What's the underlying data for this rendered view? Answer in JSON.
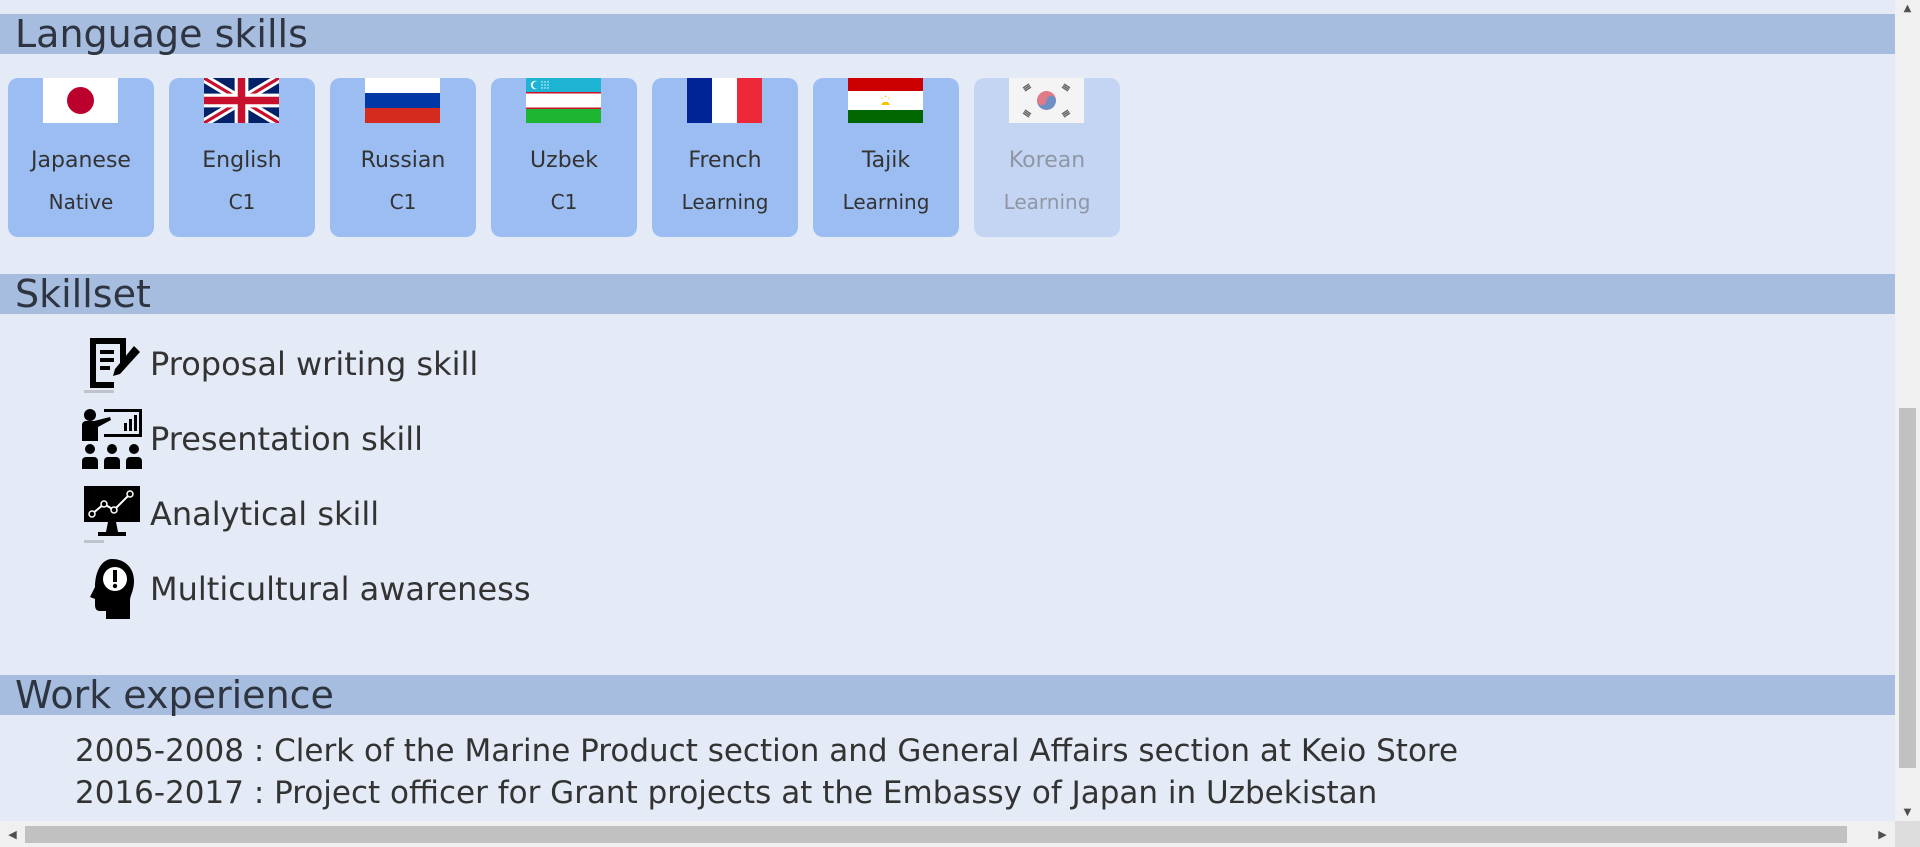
{
  "sections": {
    "languages_title": "Language skills",
    "skills_title": "Skillset",
    "work_title": "Work experience"
  },
  "languages": [
    {
      "name": "Japanese",
      "level": "Native",
      "flag": "japan-flag"
    },
    {
      "name": "English",
      "level": "C1",
      "flag": "uk-flag"
    },
    {
      "name": "Russian",
      "level": "C1",
      "flag": "russia-flag"
    },
    {
      "name": "Uzbek",
      "level": "C1",
      "flag": "uzbekistan-flag"
    },
    {
      "name": "French",
      "level": "Learning",
      "flag": "france-flag"
    },
    {
      "name": "Tajik",
      "level": "Learning",
      "flag": "tajikistan-flag"
    },
    {
      "name": "Korean",
      "level": "Learning",
      "flag": "south-korea-flag"
    }
  ],
  "skills": [
    {
      "label": "Proposal writing skill",
      "icon": "document-edit-icon"
    },
    {
      "label": "Presentation skill",
      "icon": "presentation-icon"
    },
    {
      "label": "Analytical skill",
      "icon": "analytics-monitor-icon"
    },
    {
      "label": "Multicultural awareness",
      "icon": "head-exclamation-icon"
    }
  ],
  "work": [
    "2005-2008 : Clerk of the Marine Product section and General Affairs section at Keio Store",
    "2016-2017 : Project officer for Grant projects at the Embassy of Japan in Uzbekistan"
  ],
  "colors": {
    "page_bg": "#e4ebf7",
    "header_bg": "#a7bde0",
    "card_bg": "#9cbdf2",
    "card_dim_bg": "#c4d5f3"
  }
}
